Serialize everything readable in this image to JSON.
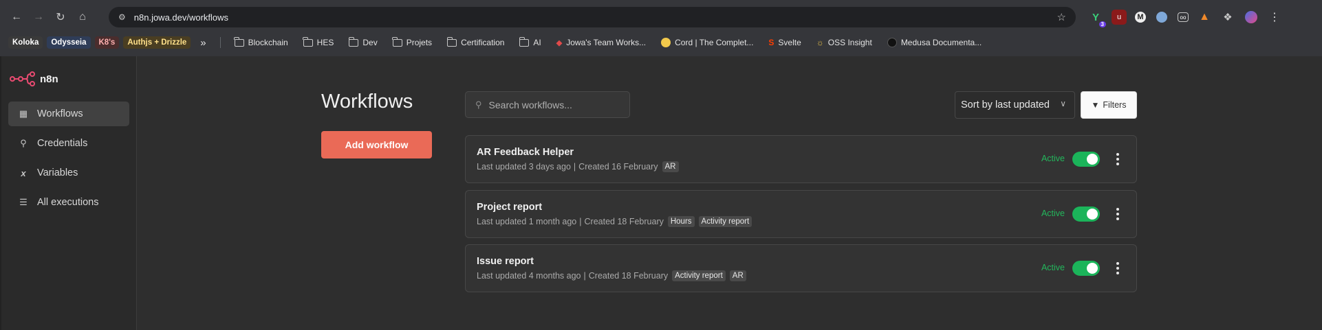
{
  "browser": {
    "url": "n8n.jowa.dev/workflows",
    "extension_badge": "3",
    "bookmark_chips": [
      {
        "label": "Koloka",
        "bg": "#3a3a3a",
        "color": "#ffffff"
      },
      {
        "label": "Odysseia",
        "bg": "#2f3d58",
        "color": "#ffffff"
      },
      {
        "label": "K8's",
        "bg": "#4a2d2d",
        "color": "#ffb0b0"
      },
      {
        "label": "Authjs + Drizzle",
        "bg": "#4a3e22",
        "color": "#ffe08a"
      }
    ],
    "bookmark_overflow": "»",
    "bookmark_folders": [
      "Blockchain",
      "HES",
      "Dev",
      "Projets",
      "Certification",
      "AI"
    ],
    "bookmark_links": [
      "Jowa's Team Works...",
      "Cord | The Complet...",
      "Svelte",
      "OSS Insight",
      "Medusa Documenta..."
    ]
  },
  "app": {
    "logo_text": "n8n",
    "accent": "#ea6a57",
    "sidebar": [
      {
        "label": "Workflows",
        "icon": "workflow-icon",
        "active": true
      },
      {
        "label": "Credentials",
        "icon": "key-icon",
        "active": false
      },
      {
        "label": "Variables",
        "icon": "variable-icon",
        "active": false
      },
      {
        "label": "All executions",
        "icon": "list-check-icon",
        "active": false
      }
    ],
    "page_title": "Workflows",
    "add_button": "Add workflow",
    "search_placeholder": "Search workflows...",
    "sort_label": "Sort by last updated",
    "filters_label": "Filters",
    "workflows": [
      {
        "name": "AR Feedback Helper",
        "updated": "Last updated 3 days ago",
        "sep": "|",
        "created": "Created 16 February",
        "tags": [
          "AR"
        ],
        "status": "Active"
      },
      {
        "name": "Project report",
        "updated": "Last updated 1 month ago",
        "sep": "|",
        "created": "Created 18 February",
        "tags": [
          "Hours",
          "Activity report"
        ],
        "status": "Active"
      },
      {
        "name": "Issue report",
        "updated": "Last updated 4 months ago",
        "sep": "|",
        "created": "Created 18 February",
        "tags": [
          "Activity report",
          "AR"
        ],
        "status": "Active"
      }
    ]
  }
}
